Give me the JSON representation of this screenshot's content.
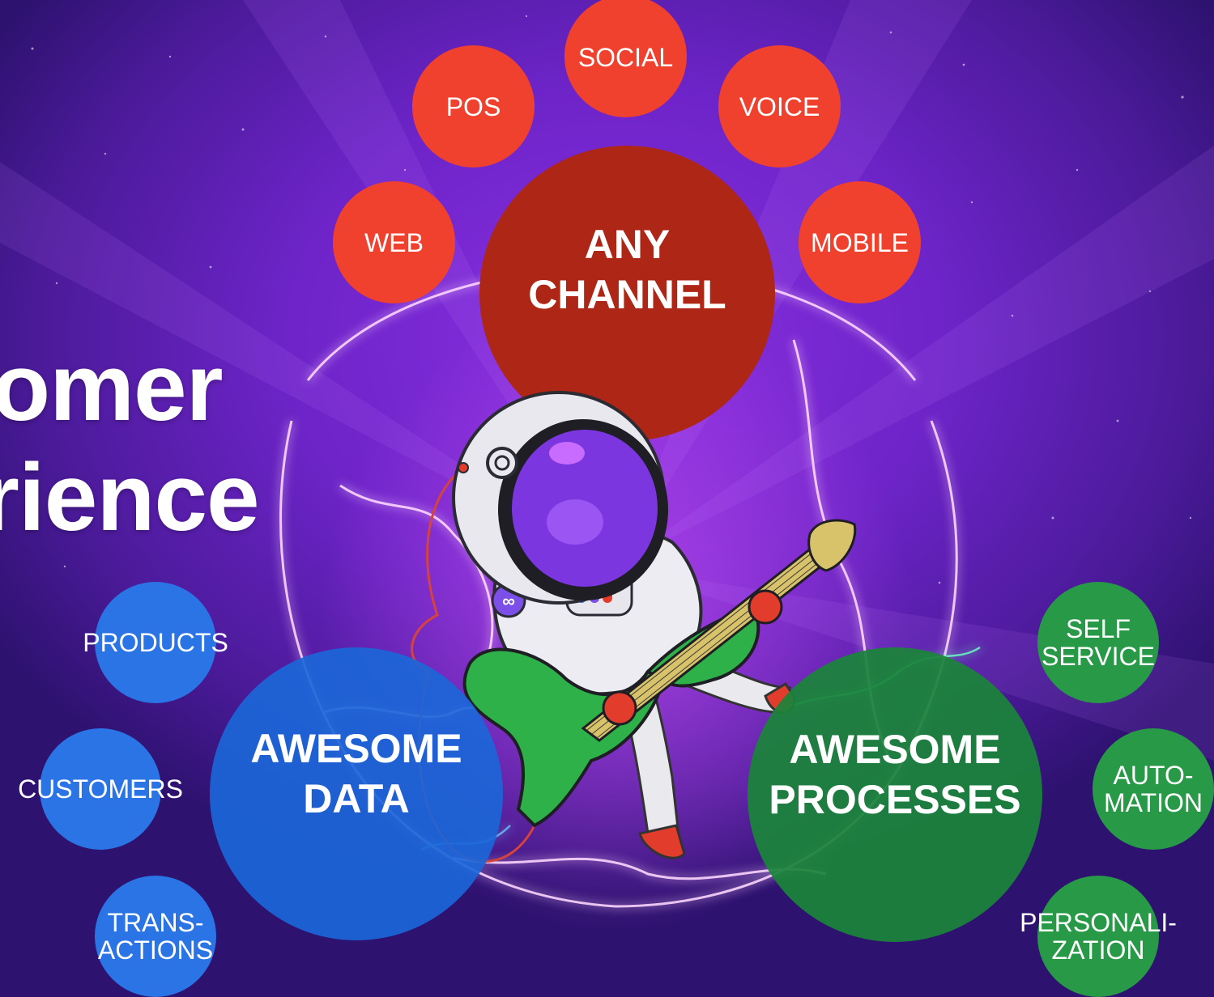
{
  "headline": {
    "line1": "omer",
    "line2": "rience"
  },
  "channel": {
    "center": "ANY\nCHANNEL",
    "items": [
      "SOCIAL",
      "POS",
      "VOICE",
      "WEB",
      "MOBILE"
    ]
  },
  "data": {
    "center": "AWESOME\nDATA",
    "items": [
      "PRODUCTS",
      "CUSTOMERS",
      "TRANS-\nACTIONS"
    ]
  },
  "processes": {
    "center": "AWESOME\nPROCESSES",
    "items": [
      "SELF\nSERVICE",
      "AUTO-\nMATION",
      "PERSONALI-\nZATION"
    ]
  },
  "colors": {
    "channel": "#f0412e",
    "channel_center": "#ad2616",
    "data": "#2a74e6",
    "processes": "#279947",
    "background": "#6d24c8"
  },
  "illustration": "astronaut playing green electric guitar inside plasma ball"
}
